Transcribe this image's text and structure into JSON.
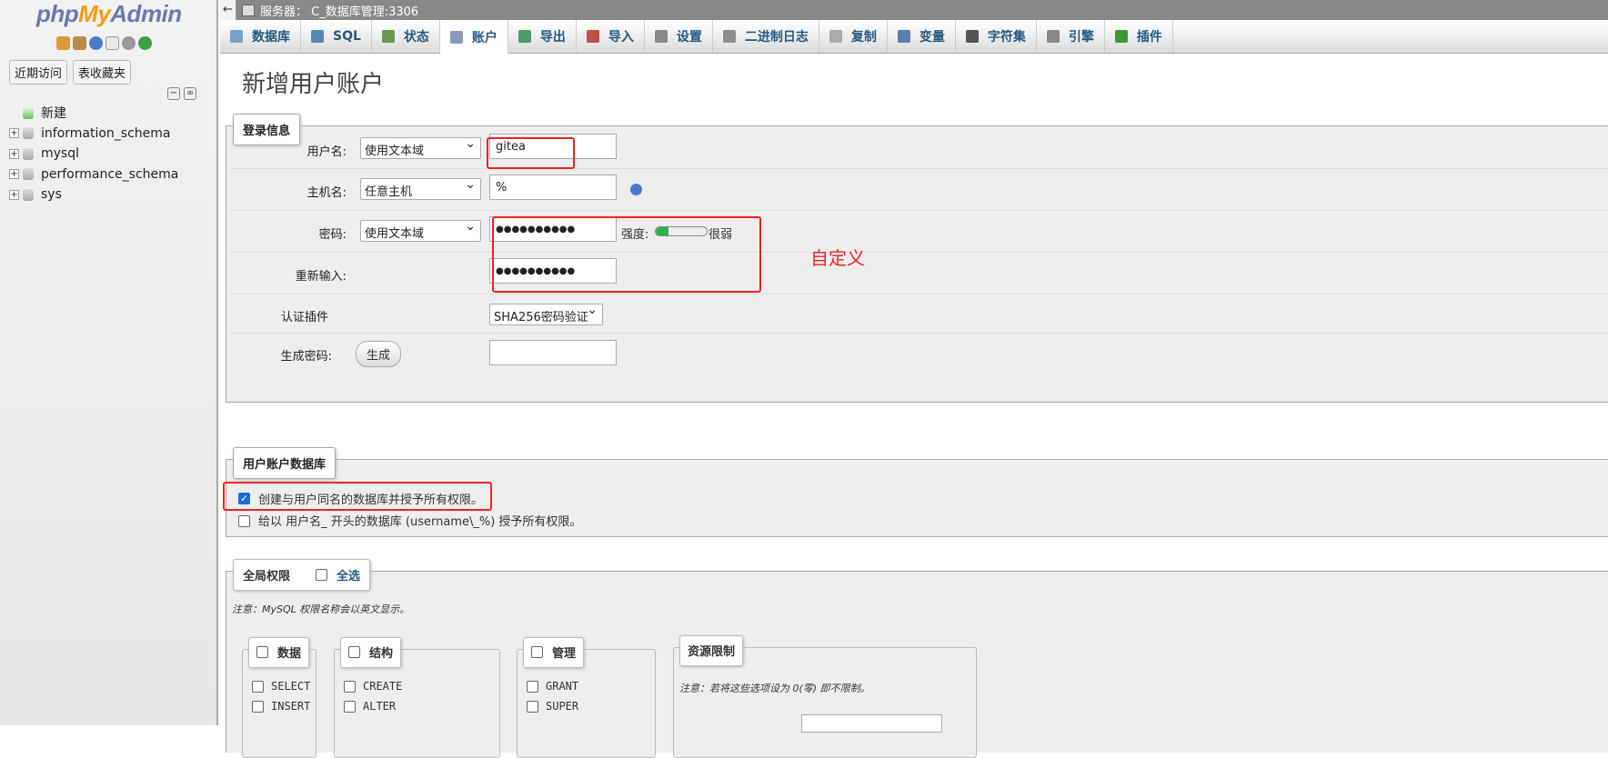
{
  "nav": {
    "logo_php": "php",
    "logo_my": "My",
    "logo_admin": "Admin",
    "recent_label": "近期访问",
    "favorites_label": "表收藏夹",
    "tree": [
      {
        "label": "新建",
        "type": "new"
      },
      {
        "label": "information_schema",
        "type": "db"
      },
      {
        "label": "mysql",
        "type": "db"
      },
      {
        "label": "performance_schema",
        "type": "db"
      },
      {
        "label": "sys",
        "type": "db"
      }
    ]
  },
  "breadcrumb": {
    "text": "服务器： C_数据库管理:3306"
  },
  "tabs": [
    {
      "label": "数据库",
      "icon": "database-icon",
      "color": "#7aa0c4"
    },
    {
      "label": "SQL",
      "icon": "sql-icon",
      "color": "#5a86b6"
    },
    {
      "label": "状态",
      "icon": "status-icon",
      "color": "#6b9a4e"
    },
    {
      "label": "账户",
      "icon": "accounts-icon",
      "color": "#8899bb"
    },
    {
      "label": "导出",
      "icon": "export-icon",
      "color": "#4f9a6a"
    },
    {
      "label": "导入",
      "icon": "import-icon",
      "color": "#c0504d"
    },
    {
      "label": "设置",
      "icon": "wrench-icon",
      "color": "#888888"
    },
    {
      "label": "二进制日志",
      "icon": "binlog-icon",
      "color": "#8c8c8c"
    },
    {
      "label": "复制",
      "icon": "replication-icon",
      "color": "#aaaaaa"
    },
    {
      "label": "变量",
      "icon": "variables-icon",
      "color": "#5a7cb0"
    },
    {
      "label": "字符集",
      "icon": "charset-icon",
      "color": "#555555"
    },
    {
      "label": "引擎",
      "icon": "engine-icon",
      "color": "#888888"
    },
    {
      "label": "插件",
      "icon": "puzzle-icon",
      "color": "#3a9a3a"
    }
  ],
  "page_title": "新增用户账户",
  "login": {
    "legend": "登录信息",
    "username_label": "用户名:",
    "username_select": "使用文本域",
    "username_value": "gitea",
    "host_label": "主机名:",
    "host_select": "任意主机",
    "host_value": "%",
    "password_label": "密码:",
    "password_select": "使用文本域",
    "password_value": "●●●●●●●●●●",
    "strength_label": "强度:",
    "strength_value": "很弱",
    "strength_fraction": 0.25,
    "reenter_label": "重新输入:",
    "reenter_value": "●●●●●●●●●●",
    "auth_label": "认证插件",
    "auth_select": "SHA256密码验证",
    "generate_label": "生成密码:",
    "generate_button": "生成",
    "generated_value": ""
  },
  "annotation": {
    "text": "自定义",
    "color": "#e22222"
  },
  "userdb": {
    "legend": "用户账户数据库",
    "option1": "创建与用户同名的数据库并授予所有权限。",
    "option1_checked": true,
    "option2": "给以 用户名_ 开头的数据库 (username\\_%) 授予所有权限。",
    "option2_checked": false
  },
  "global": {
    "legend": "全局权限",
    "select_all": "全选",
    "note": "注意：MySQL 权限名称会以英文显示。",
    "data_legend": "数据",
    "data_items": [
      "SELECT",
      "INSERT"
    ],
    "structure_legend": "结构",
    "structure_items": [
      "CREATE",
      "ALTER"
    ],
    "admin_legend": "管理",
    "admin_items": [
      "GRANT",
      "SUPER"
    ],
    "resource_legend": "资源限制",
    "resource_note": "注意：若将这些选项设为 0(零) 即不限制。"
  }
}
